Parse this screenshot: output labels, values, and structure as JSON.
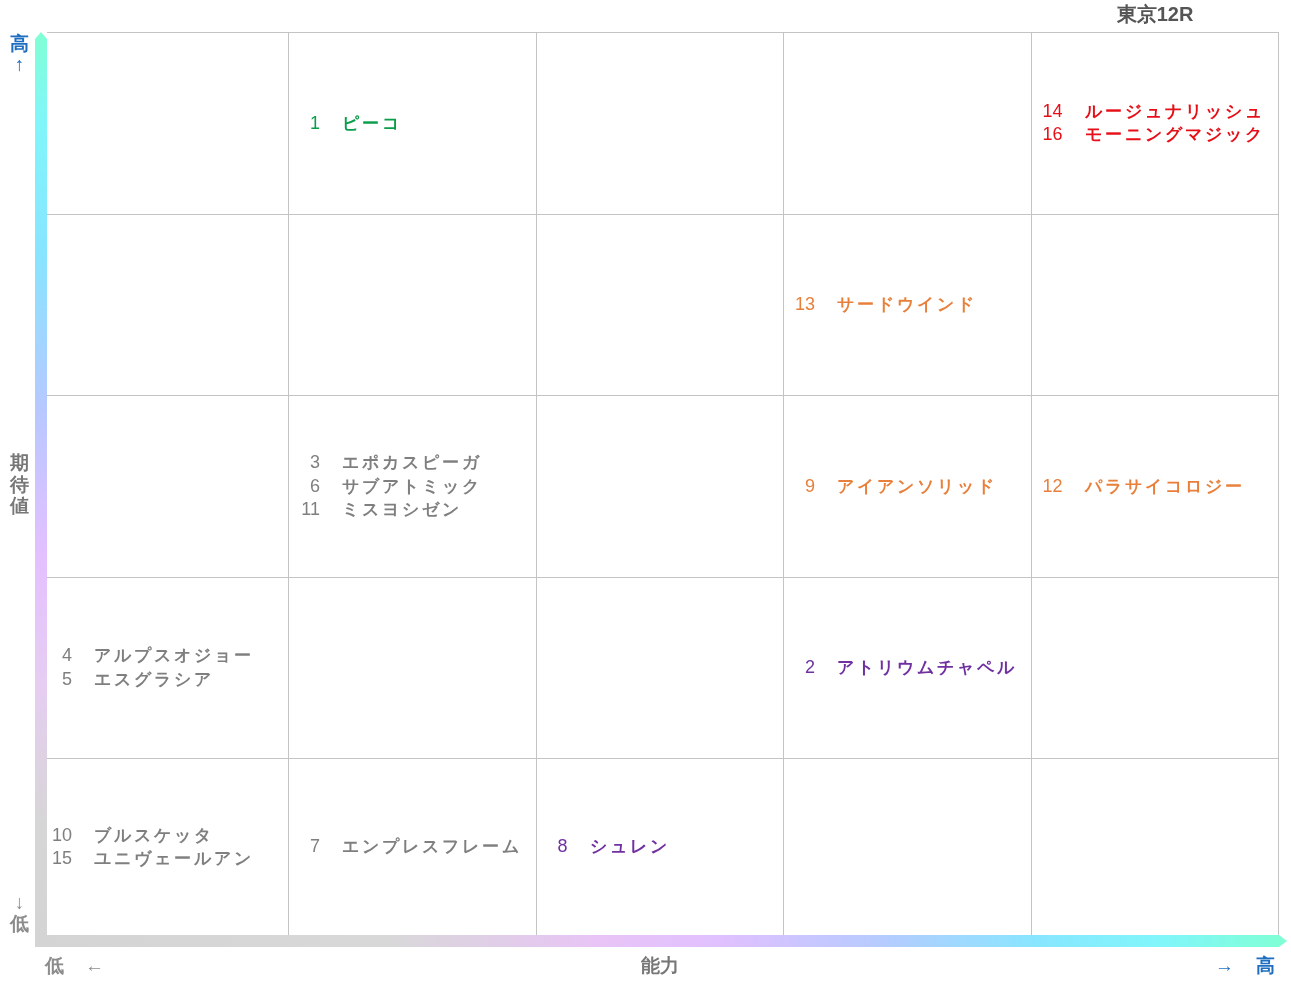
{
  "title": "東京12R",
  "y_axis": {
    "high": "高",
    "up_arrow": "↑",
    "label": "期待値",
    "down_arrow": "↓",
    "low": "低"
  },
  "grid": {
    "rows": [
      {
        "cells": [
          {},
          {
            "entries": [
              {
                "number": "1",
                "name": "ピーコ",
                "color": "#0a9e4b"
              }
            ]
          },
          {},
          {},
          {
            "entries": [
              {
                "number": "14",
                "name": "ルージュナリッシュ",
                "color": "#e60f18"
              },
              {
                "number": "16",
                "name": "モーニングマジック",
                "color": "#e60f18"
              }
            ]
          }
        ]
      },
      {
        "cells": [
          {},
          {},
          {},
          {
            "entries": [
              {
                "number": "13",
                "name": "サードウインド",
                "color": "#e8803c"
              }
            ]
          },
          {}
        ]
      },
      {
        "cells": [
          {},
          {
            "entries": [
              {
                "number": "3",
                "name": "エポカスピーガ",
                "color": "#7f7f7f"
              },
              {
                "number": "6",
                "name": "サブアトミック",
                "color": "#7f7f7f"
              },
              {
                "number": "11",
                "name": "ミスヨシゼン",
                "color": "#7f7f7f"
              }
            ]
          },
          {},
          {
            "entries": [
              {
                "number": "9",
                "name": "アイアンソリッド",
                "color": "#e8803c"
              }
            ]
          },
          {
            "entries": [
              {
                "number": "12",
                "name": "パラサイコロジー",
                "color": "#e8803c"
              }
            ]
          }
        ]
      },
      {
        "cells": [
          {
            "entries": [
              {
                "number": "4",
                "name": "アルプスオジョー",
                "color": "#7f7f7f"
              },
              {
                "number": "5",
                "name": "エスグラシア",
                "color": "#7f7f7f"
              }
            ]
          },
          {},
          {},
          {
            "entries": [
              {
                "number": "2",
                "name": "アトリウムチャペル",
                "color": "#7030a0"
              }
            ]
          },
          {}
        ]
      },
      {
        "cells": [
          {
            "entries": [
              {
                "number": "10",
                "name": "ブルスケッタ",
                "color": "#7f7f7f"
              },
              {
                "number": "15",
                "name": "ユニヴェールアン",
                "color": "#7f7f7f"
              }
            ]
          },
          {
            "entries": [
              {
                "number": "7",
                "name": "エンプレスフレーム",
                "color": "#7f7f7f"
              }
            ]
          },
          {
            "entries": [
              {
                "number": "8",
                "name": "シュレン",
                "color": "#7030a0"
              }
            ]
          },
          {},
          {}
        ]
      }
    ]
  },
  "x_axis": {
    "low": "低",
    "left_arrow": "←",
    "label": "能力",
    "right_arrow": "→",
    "high": "高"
  }
}
